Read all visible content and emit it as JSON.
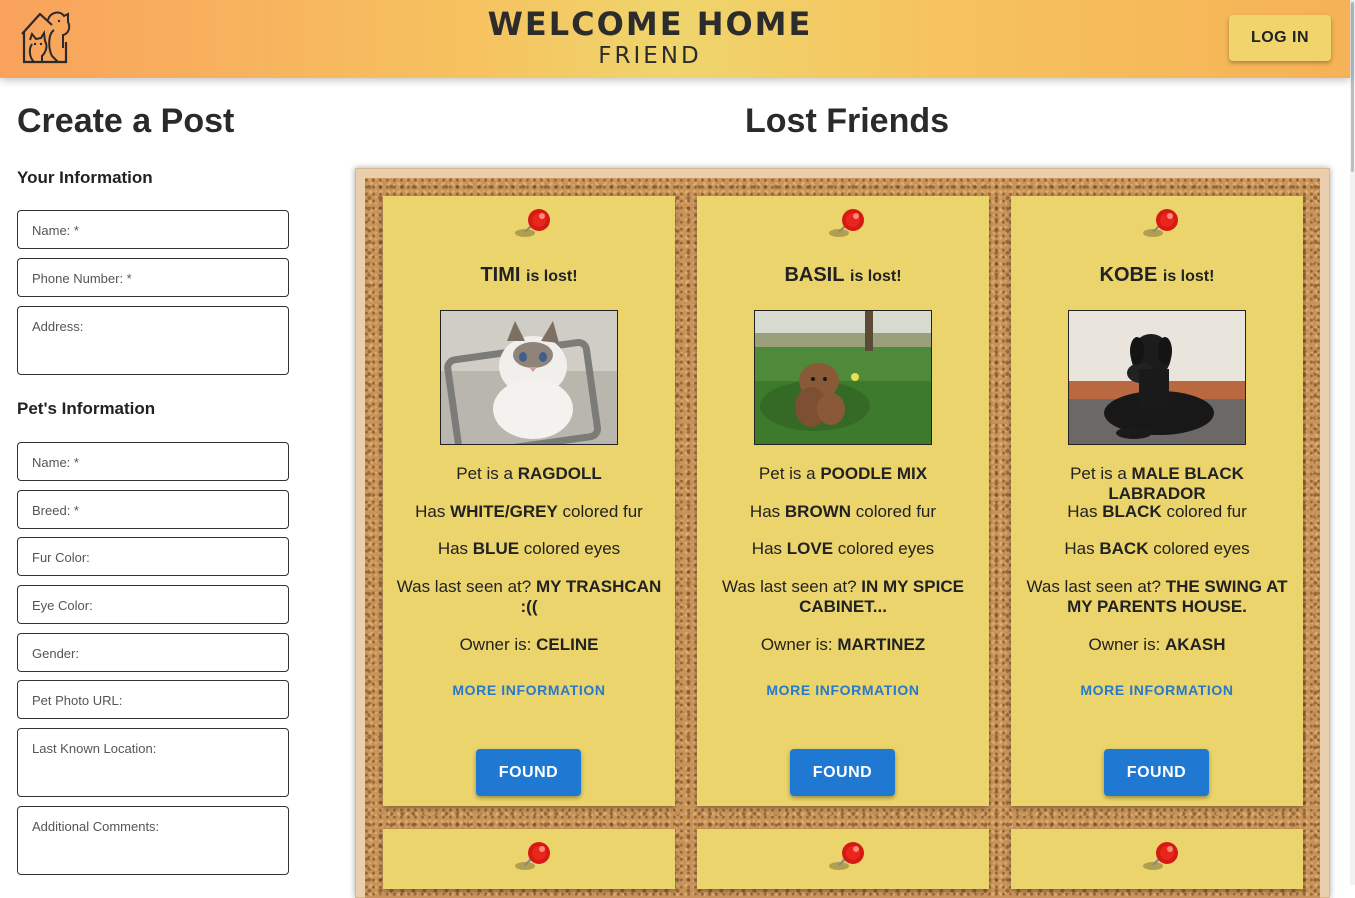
{
  "header": {
    "brand_main": "WELCOME HOME",
    "brand_sub": "FRIEND",
    "login_label": "LOG IN",
    "logo_icon": "pets-house-icon",
    "accent_color": "#f6c25f"
  },
  "form": {
    "title": "Create a Post",
    "your_info_label": "Your Information",
    "pet_info_label": "Pet's Information",
    "owner_fields": [
      {
        "placeholder": "Name: *"
      },
      {
        "placeholder": "Phone Number: *"
      },
      {
        "placeholder": "Address:"
      }
    ],
    "pet_fields": [
      {
        "placeholder": "Name: *"
      },
      {
        "placeholder": "Breed: *"
      },
      {
        "placeholder": "Fur Color:"
      },
      {
        "placeholder": "Eye Color:"
      },
      {
        "placeholder": "Gender:"
      },
      {
        "placeholder": "Pet Photo URL:"
      },
      {
        "placeholder": "Last Known Location:"
      },
      {
        "placeholder": "Additional Comments:"
      }
    ]
  },
  "board": {
    "title": "Lost Friends",
    "lost_suffix": "is lost!",
    "pet_is_prefix": "Pet is a",
    "has_prefix": "Has",
    "fur_suffix": "colored fur",
    "eyes_suffix": "colored eyes",
    "seen_prefix": "Was last seen at?",
    "owner_prefix": "Owner is:",
    "more_label": "MORE INFORMATION",
    "found_label": "FOUND",
    "pin_icon": "red-pushpin-icon",
    "cards": [
      {
        "name": "TIMI",
        "type": "RAGDOLL",
        "fur": "WHITE/GREY",
        "eyes": "BLUE",
        "seen": "MY TRASHCAN :((",
        "owner": "CELINE"
      },
      {
        "name": "BASIL",
        "type": "POODLE MIX",
        "fur": "BROWN",
        "eyes": "LOVE",
        "seen": "IN MY SPICE CABINET...",
        "owner": "MARTINEZ"
      },
      {
        "name": "KOBE",
        "type": "MALE BLACK LABRADOR",
        "fur": "BLACK",
        "eyes": "BACK",
        "seen": "THE SWING AT MY PARENTS HOUSE.",
        "owner": "AKASH"
      }
    ]
  }
}
